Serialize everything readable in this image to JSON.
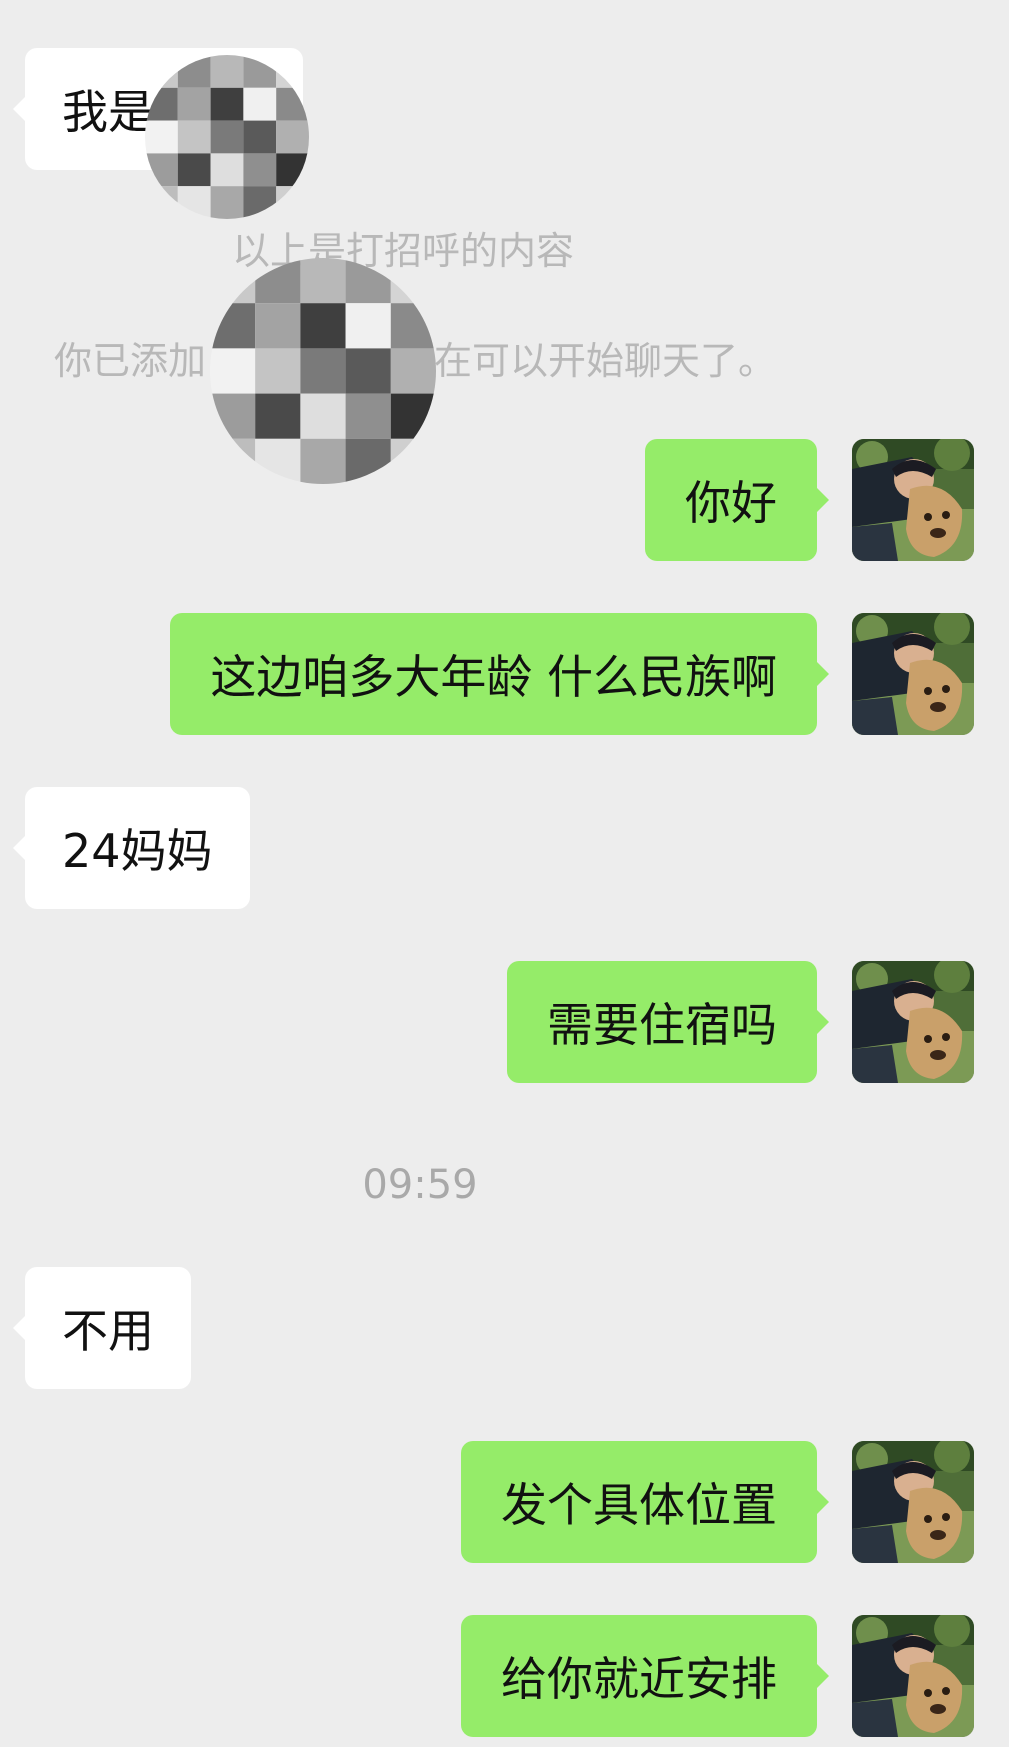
{
  "system": {
    "greeting_note": "以上是打招呼的内容",
    "added_prefix": "你已添加",
    "added_suffix": "在可以开始聊天了。"
  },
  "timestamp": "09:59",
  "messages": [
    {
      "from": "contact",
      "text": "我是"
    },
    {
      "from": "me",
      "text": "你好"
    },
    {
      "from": "me",
      "text": "这边咱多大年龄 什么民族啊"
    },
    {
      "from": "contact",
      "text": "24妈妈"
    },
    {
      "from": "me",
      "text": "需要住宿吗"
    },
    {
      "from": "contact",
      "text": "不用"
    },
    {
      "from": "me",
      "text": "发个具体位置"
    },
    {
      "from": "me",
      "text": "给你就近安排"
    }
  ],
  "colors": {
    "background": "#ededed",
    "incoming_bubble": "#ffffff",
    "outgoing_bubble": "#95ec69",
    "system_text": "#b8b8b8"
  },
  "icons": {
    "avatar": "user-avatar-photo",
    "redaction": "pixelated-mosaic"
  }
}
